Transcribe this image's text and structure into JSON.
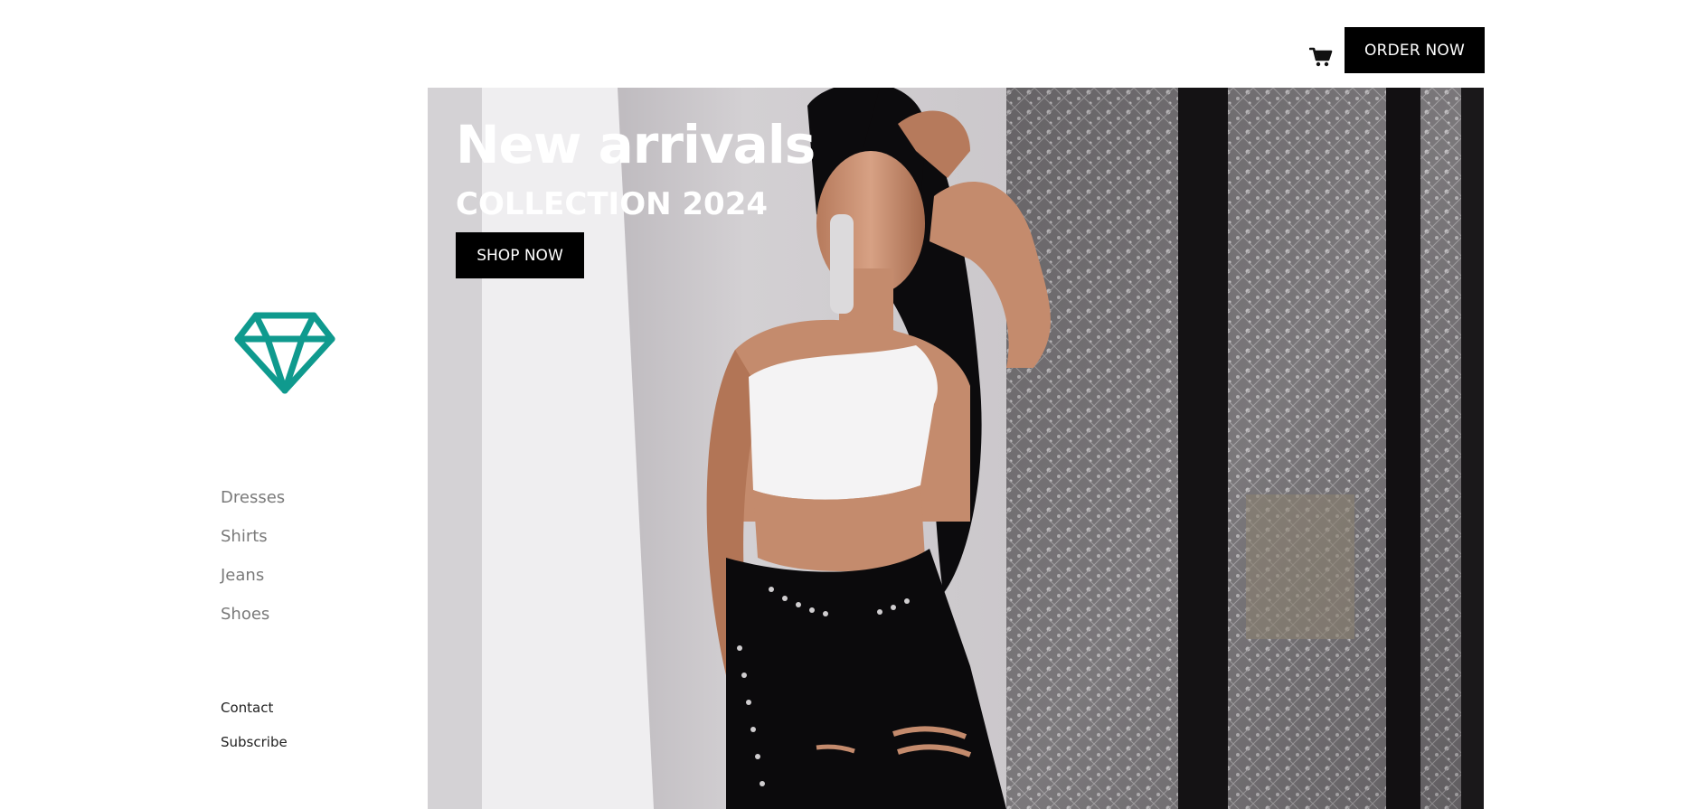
{
  "header": {
    "cart_icon": "shopping-cart-icon",
    "order_label": "ORDER NOW"
  },
  "sidebar": {
    "logo_icon": "diamond-icon",
    "logo_color": "#0f9a8e",
    "nav": [
      {
        "label": "Dresses"
      },
      {
        "label": "Shirts"
      },
      {
        "label": "Jeans"
      },
      {
        "label": "Shoes"
      }
    ],
    "links": [
      {
        "label": "Contact"
      },
      {
        "label": "Subscribe"
      }
    ]
  },
  "hero": {
    "title": "New arrivals",
    "subtitle": "COLLECTION 2024",
    "cta_label": "SHOP NOW"
  }
}
